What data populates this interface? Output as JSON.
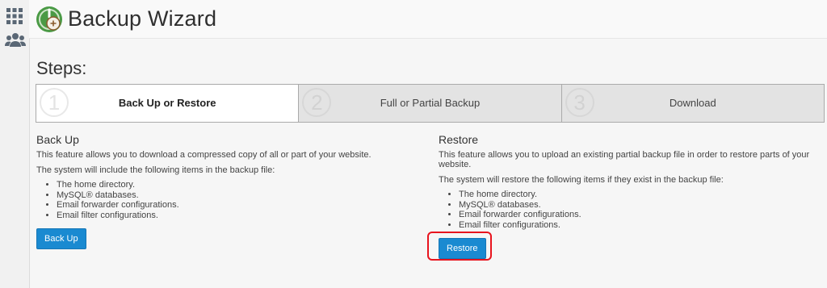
{
  "sidebar": {
    "items": [
      {
        "icon": "grid-icon",
        "label": ""
      },
      {
        "icon": "users-icon",
        "label": ""
      }
    ]
  },
  "header": {
    "title": "Backup Wizard"
  },
  "steps": {
    "heading": "Steps:",
    "items": [
      {
        "number": "1",
        "label": "Back Up or Restore",
        "active": true
      },
      {
        "number": "2",
        "label": "Full or Partial Backup",
        "active": false
      },
      {
        "number": "3",
        "label": "Download",
        "active": false
      }
    ]
  },
  "backup": {
    "title": "Back Up",
    "description": "This feature allows you to download a compressed copy of all or part of your website.",
    "note": "The system will include the following items in the backup file:",
    "items": [
      "The home directory.",
      "MySQL® databases.",
      "Email forwarder configurations.",
      "Email filter configurations."
    ],
    "button": "Back Up"
  },
  "restore": {
    "title": "Restore",
    "description": "This feature allows you to upload an existing partial backup file in order to restore parts of your website.",
    "note": "The system will restore the following items if they exist in the backup file:",
    "items": [
      "The home directory.",
      "MySQL® databases.",
      "Email forwarder configurations.",
      "Email filter configurations."
    ],
    "button": "Restore"
  },
  "colors": {
    "accent": "#1a8ad1",
    "highlight": "#e8141e",
    "logo_green": "#4a9a45"
  }
}
